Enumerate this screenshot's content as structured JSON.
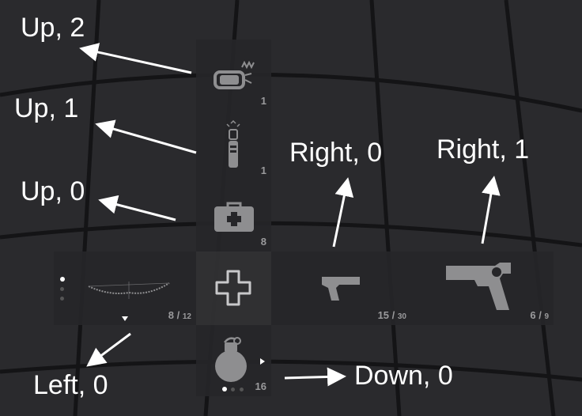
{
  "wheel": {
    "up": [
      {
        "icon": "medkit-icon",
        "count": "8"
      },
      {
        "icon": "flashlight-icon",
        "count": "1"
      },
      {
        "icon": "explosive-charge-icon",
        "count": "1"
      }
    ],
    "center": {
      "icon": "plus-cross-icon"
    },
    "left": [
      {
        "icon": "bow-icon",
        "count": "8",
        "max": "12"
      }
    ],
    "right": [
      {
        "icon": "pistol-icon",
        "count": "15",
        "max": "30"
      },
      {
        "icon": "revolver-icon",
        "count": "6",
        "max": "9"
      }
    ],
    "down": [
      {
        "icon": "grenade-icon",
        "count": "16"
      }
    ]
  },
  "annotations": {
    "up2": "Up, 2",
    "up1": "Up, 1",
    "up0": "Up, 0",
    "right0": "Right, 0",
    "right1": "Right, 1",
    "left0": "Left, 0",
    "down0": "Down, 0"
  },
  "colors": {
    "background": "#2a2a2d",
    "slot": "#262629",
    "icon": "#8e8e90",
    "label": "#ffffff"
  }
}
